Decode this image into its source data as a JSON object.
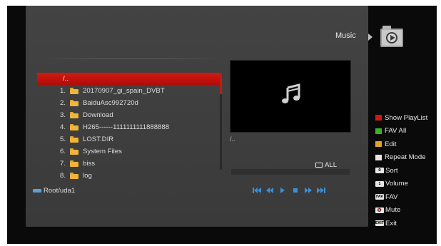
{
  "header": {
    "title": "Music",
    "icon": "media-player-icon"
  },
  "file_list": {
    "parent_label": "/..",
    "items": [
      {
        "num": "1.",
        "name": "20170907_gi_spain_DVBT"
      },
      {
        "num": "2.",
        "name": "BaiduAsc992720d"
      },
      {
        "num": "3.",
        "name": "Download"
      },
      {
        "num": "4.",
        "name": "H265------1111111111888888"
      },
      {
        "num": "5.",
        "name": "LOST.DIR"
      },
      {
        "num": "6.",
        "name": "System Files"
      },
      {
        "num": "7.",
        "name": "biss"
      },
      {
        "num": "8.",
        "name": "log"
      }
    ]
  },
  "path": "Root/uda1",
  "preview": {
    "path": "/..",
    "icon": "music-note-icon"
  },
  "repeat_label": "ALL",
  "transport": [
    "skip-back-icon",
    "rewind-icon",
    "play-icon",
    "stop-icon",
    "fast-forward-icon",
    "skip-forward-icon"
  ],
  "legend": [
    {
      "kind": "swatch",
      "color": "#d01818",
      "label": "Show PlayList"
    },
    {
      "kind": "swatch",
      "color": "#3fae2a",
      "label": "FAV All"
    },
    {
      "kind": "swatch",
      "color": "#e0a22a",
      "label": "Edit"
    },
    {
      "kind": "swatch",
      "color": "#e6e6e6",
      "label": "Repeat Mode"
    },
    {
      "kind": "key",
      "key": "0",
      "label": "Sort"
    },
    {
      "kind": "key",
      "key": "1",
      "label": "Volume"
    },
    {
      "kind": "key",
      "key": "FAV",
      "label": "FAV"
    },
    {
      "kind": "key",
      "key": "🔇",
      "label": "Mute"
    },
    {
      "kind": "key",
      "key": "EXIT",
      "label": "Exit"
    }
  ],
  "colors": {
    "selection": "#c31410",
    "folder": "#f0b43a",
    "accent_blue": "#3a8fd8"
  }
}
